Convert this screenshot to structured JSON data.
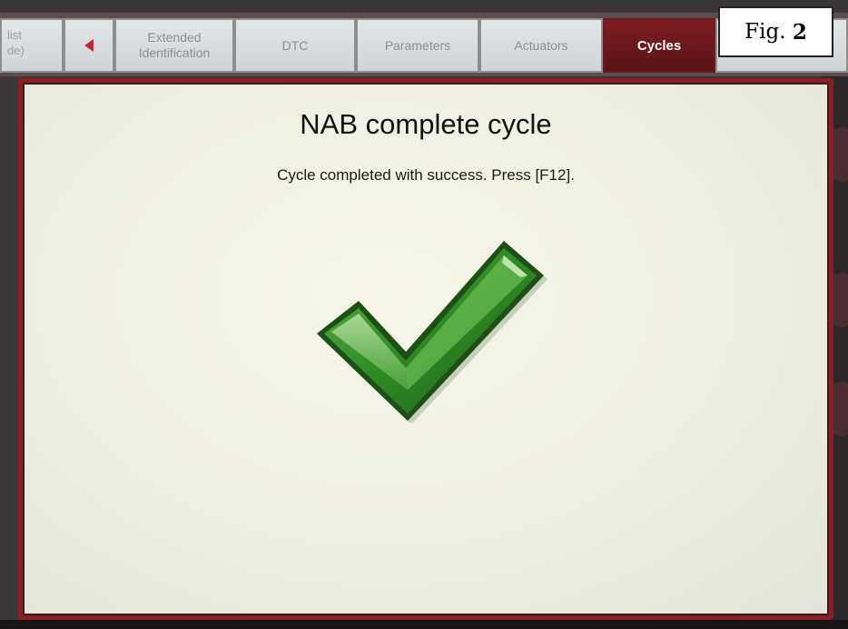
{
  "tabs": {
    "list_label_line1": "list",
    "list_label_line2": "de)",
    "extended_line1": "Extended",
    "extended_line2": "Identification",
    "dtc": "DTC",
    "parameters": "Parameters",
    "actuators": "Actuators",
    "cycles": "Cycles"
  },
  "figure_label": {
    "prefix": "Fig.",
    "number": "2"
  },
  "dialog": {
    "title": "NAB complete cycle",
    "message": "Cycle completed with success. Press [F12].",
    "status_icon": "check-mark-icon",
    "status_color": "#3f9a2e"
  },
  "colors": {
    "accent": "#7d1d22",
    "panel_border": "#8a1f25",
    "tab_inactive": "#d8dcdf"
  },
  "icons": {
    "back": "chevron-left-icon"
  }
}
